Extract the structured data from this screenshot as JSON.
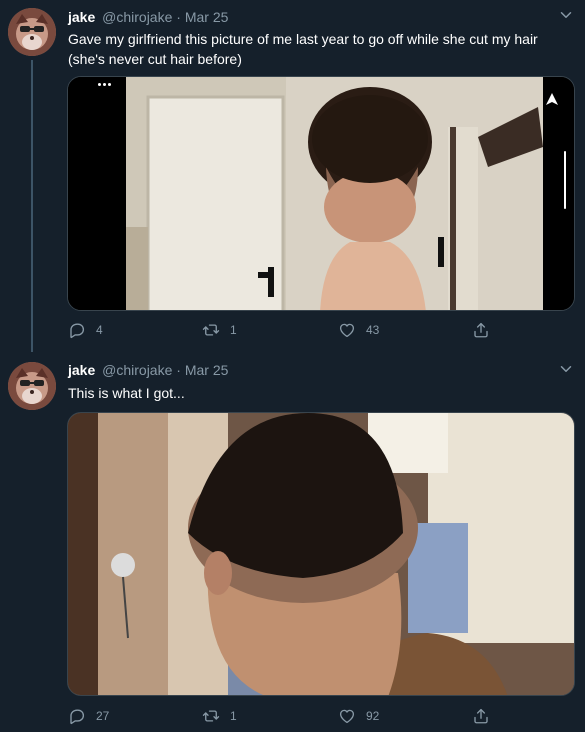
{
  "tweets": [
    {
      "name": "jake",
      "handle": "@chirojake",
      "separator": "·",
      "date": "Mar 25",
      "text": "Gave my girlfriend this picture of me last year to go off while she cut my hair (she's never cut hair before)",
      "media_description": "back of head photo",
      "counts": {
        "replies": "4",
        "retweets": "1",
        "likes": "43"
      }
    },
    {
      "name": "jake",
      "handle": "@chirojake",
      "separator": "·",
      "date": "Mar 25",
      "text": "This is what I got...",
      "media_description": "haircut result photo",
      "counts": {
        "replies": "27",
        "retweets": "1",
        "likes": "92"
      }
    }
  ],
  "colors": {
    "background": "#15202b",
    "secondary_text": "#8899a6",
    "border": "#38444d"
  },
  "icons": [
    "reply-icon",
    "retweet-icon",
    "like-icon",
    "share-icon",
    "chevron-down-icon"
  ]
}
